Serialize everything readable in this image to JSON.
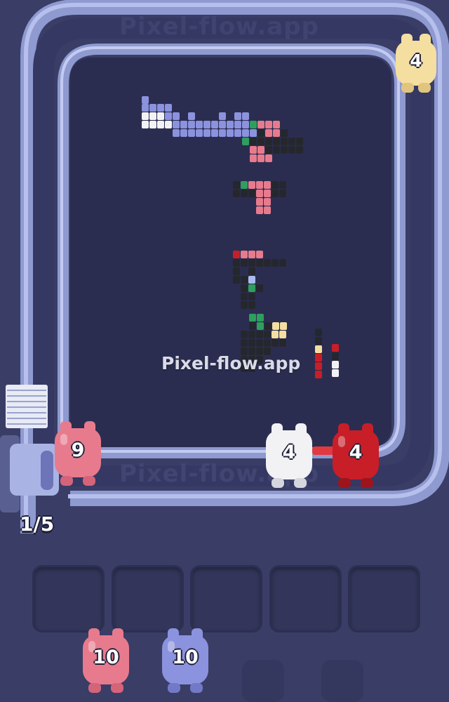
{
  "watermark": "Pixel-flow.app",
  "overlay_text": "Pixel-flow.app",
  "queue_counter": "1/5",
  "colors": {
    "background": "#3a3d66",
    "track": "#8e9ad0",
    "track_inner": "#2b2d50",
    "pink": "#e77b8d",
    "blue": "#8b92de",
    "white": "#f2f2f5",
    "red": "#c81e28",
    "yellow": "#f5dfa0",
    "dark": "#25272e",
    "green": "#2e9f5d"
  },
  "track_shooters": [
    {
      "name": "shooter-pink",
      "color": "pink",
      "value": "9"
    },
    {
      "name": "shooter-white",
      "color": "white",
      "value": "4"
    },
    {
      "name": "shooter-red",
      "color": "red",
      "value": "4"
    },
    {
      "name": "shooter-yellow",
      "color": "yellow",
      "value": "4"
    }
  ],
  "slots": [
    "",
    "",
    "",
    "",
    ""
  ],
  "queue_shooters": [
    {
      "name": "queue-pig-pink",
      "color": "pink",
      "value": "10"
    },
    {
      "name": "queue-pig-blue",
      "color": "blue",
      "value": "10"
    }
  ]
}
